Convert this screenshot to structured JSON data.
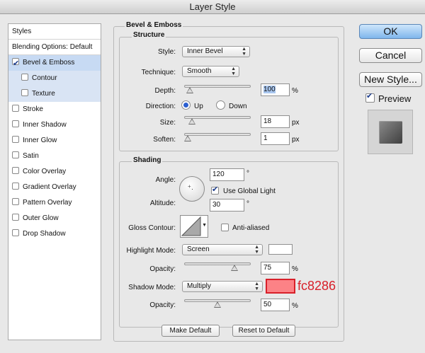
{
  "window": {
    "title": "Layer Style"
  },
  "style_list": {
    "header": "Styles",
    "blending": "Blending Options: Default",
    "items": [
      {
        "label": "Bevel & Emboss",
        "checked": true
      },
      {
        "label": "Contour",
        "checked": false
      },
      {
        "label": "Texture",
        "checked": false
      },
      {
        "label": "Stroke",
        "checked": false
      },
      {
        "label": "Inner Shadow",
        "checked": false
      },
      {
        "label": "Inner Glow",
        "checked": false
      },
      {
        "label": "Satin",
        "checked": false
      },
      {
        "label": "Color Overlay",
        "checked": false
      },
      {
        "label": "Gradient Overlay",
        "checked": false
      },
      {
        "label": "Pattern Overlay",
        "checked": false
      },
      {
        "label": "Outer Glow",
        "checked": false
      },
      {
        "label": "Drop Shadow",
        "checked": false
      }
    ]
  },
  "bevel": {
    "title": "Bevel & Emboss",
    "structure": {
      "title": "Structure",
      "style_label": "Style:",
      "style_value": "Inner Bevel",
      "technique_label": "Technique:",
      "technique_value": "Smooth",
      "depth_label": "Depth:",
      "depth_value": "100",
      "depth_unit": "%",
      "direction_label": "Direction:",
      "direction_up": "Up",
      "direction_down": "Down",
      "size_label": "Size:",
      "size_value": "18",
      "size_unit": "px",
      "soften_label": "Soften:",
      "soften_value": "1",
      "soften_unit": "px"
    },
    "shading": {
      "title": "Shading",
      "angle_label": "Angle:",
      "angle_value": "120",
      "angle_unit": "°",
      "global_light_label": "Use Global Light",
      "altitude_label": "Altitude:",
      "altitude_value": "30",
      "altitude_unit": "°",
      "gloss_label": "Gloss Contour:",
      "anti_aliased_label": "Anti-aliased",
      "highlight_mode_label": "Highlight Mode:",
      "highlight_mode_value": "Screen",
      "highlight_color": "#ffffff",
      "highlight_opacity_label": "Opacity:",
      "highlight_opacity_value": "75",
      "highlight_opacity_unit": "%",
      "shadow_mode_label": "Shadow Mode:",
      "shadow_mode_value": "Multiply",
      "shadow_color": "#fc8286",
      "shadow_color_annotation": "fc8286",
      "shadow_opacity_label": "Opacity:",
      "shadow_opacity_value": "50",
      "shadow_opacity_unit": "%"
    },
    "make_default": "Make Default",
    "reset_default": "Reset to Default"
  },
  "buttons": {
    "ok": "OK",
    "cancel": "Cancel",
    "new_style": "New Style...",
    "preview": "Preview"
  },
  "colors": {
    "annotation": "#d8202a",
    "ok_button": "#7fb6ec"
  }
}
